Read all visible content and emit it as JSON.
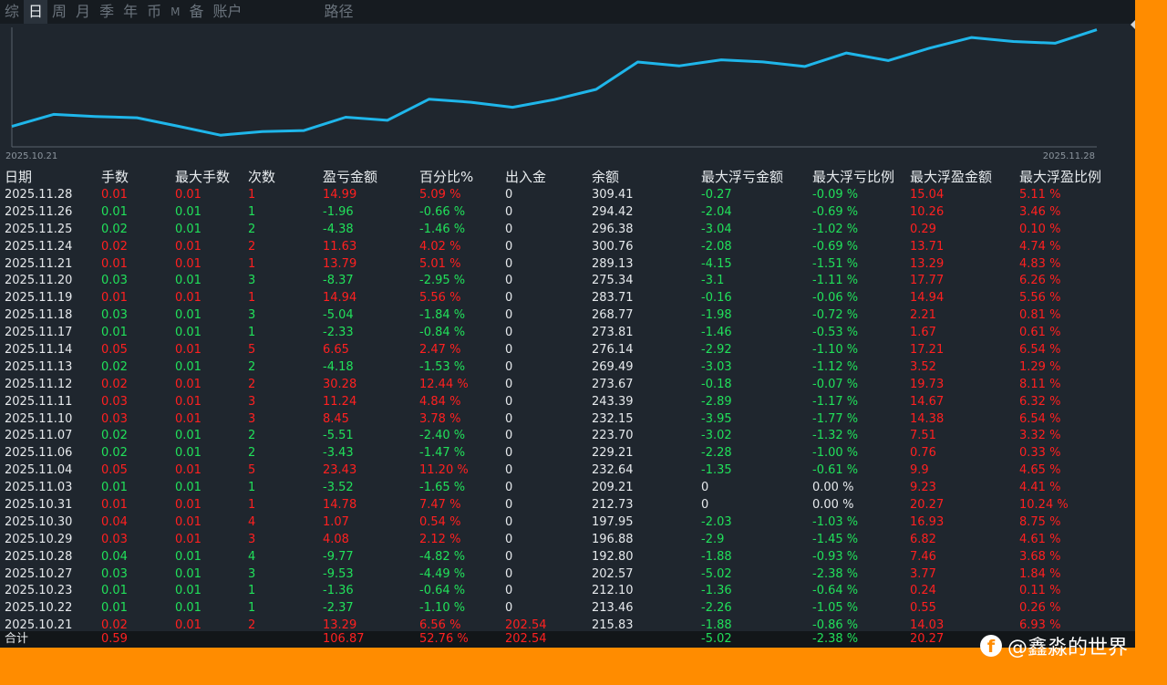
{
  "tabs": [
    "综",
    "日",
    "周",
    "月",
    "季",
    "年",
    "币",
    "M",
    "备",
    "账户",
    "路径"
  ],
  "active_tab": 1,
  "chart_data": {
    "type": "line",
    "title": "",
    "xlabel": "",
    "ylabel": "",
    "x_start_label": "2025.10.21",
    "x_end_label": "2025.11.28",
    "x": [
      "2025.10.21",
      "2025.10.22",
      "2025.10.23",
      "2025.10.27",
      "2025.10.28",
      "2025.10.29",
      "2025.10.30",
      "2025.10.31",
      "2025.11.03",
      "2025.11.04",
      "2025.11.06",
      "2025.11.07",
      "2025.11.10",
      "2025.11.11",
      "2025.11.12",
      "2025.11.13",
      "2025.11.14",
      "2025.11.17",
      "2025.11.18",
      "2025.11.19",
      "2025.11.20",
      "2025.11.21",
      "2025.11.24",
      "2025.11.25",
      "2025.11.26",
      "2025.11.28"
    ],
    "values": [
      202.54,
      215.83,
      213.46,
      212.1,
      202.57,
      192.8,
      196.88,
      197.95,
      212.73,
      209.21,
      232.64,
      229.21,
      223.7,
      232.15,
      243.39,
      273.67,
      269.49,
      276.14,
      273.81,
      268.77,
      283.71,
      275.34,
      289.13,
      300.76,
      296.38,
      294.42,
      309.41
    ],
    "ylim": [
      190,
      312
    ],
    "grid": false,
    "line_color": "#1fb6ea"
  },
  "table": {
    "headers": [
      "日期",
      "手数",
      "最大手数",
      "次数",
      "盈亏金额",
      "百分比%",
      "出入金",
      "余额",
      "最大浮亏金额",
      "最大浮亏比例",
      "最大浮盈金额",
      "最大浮盈比例"
    ],
    "rows": [
      [
        "2025.11.28",
        "0.01",
        "0.01",
        "1",
        "14.99",
        "5.09 %",
        "0",
        "309.41",
        "-0.27",
        "-0.09 %",
        "15.04",
        "5.11 %"
      ],
      [
        "2025.11.26",
        "0.01",
        "0.01",
        "1",
        "-1.96",
        "-0.66 %",
        "0",
        "294.42",
        "-2.04",
        "-0.69 %",
        "10.26",
        "3.46 %"
      ],
      [
        "2025.11.25",
        "0.02",
        "0.01",
        "2",
        "-4.38",
        "-1.46 %",
        "0",
        "296.38",
        "-3.04",
        "-1.02 %",
        "0.29",
        "0.10 %"
      ],
      [
        "2025.11.24",
        "0.02",
        "0.01",
        "2",
        "11.63",
        "4.02 %",
        "0",
        "300.76",
        "-2.08",
        "-0.69 %",
        "13.71",
        "4.74 %"
      ],
      [
        "2025.11.21",
        "0.01",
        "0.01",
        "1",
        "13.79",
        "5.01 %",
        "0",
        "289.13",
        "-4.15",
        "-1.51 %",
        "13.29",
        "4.83 %"
      ],
      [
        "2025.11.20",
        "0.03",
        "0.01",
        "3",
        "-8.37",
        "-2.95 %",
        "0",
        "275.34",
        "-3.1",
        "-1.11 %",
        "17.77",
        "6.26 %"
      ],
      [
        "2025.11.19",
        "0.01",
        "0.01",
        "1",
        "14.94",
        "5.56 %",
        "0",
        "283.71",
        "-0.16",
        "-0.06 %",
        "14.94",
        "5.56 %"
      ],
      [
        "2025.11.18",
        "0.03",
        "0.01",
        "3",
        "-5.04",
        "-1.84 %",
        "0",
        "268.77",
        "-1.98",
        "-0.72 %",
        "2.21",
        "0.81 %"
      ],
      [
        "2025.11.17",
        "0.01",
        "0.01",
        "1",
        "-2.33",
        "-0.84 %",
        "0",
        "273.81",
        "-1.46",
        "-0.53 %",
        "1.67",
        "0.61 %"
      ],
      [
        "2025.11.14",
        "0.05",
        "0.01",
        "5",
        "6.65",
        "2.47 %",
        "0",
        "276.14",
        "-2.92",
        "-1.10 %",
        "17.21",
        "6.54 %"
      ],
      [
        "2025.11.13",
        "0.02",
        "0.01",
        "2",
        "-4.18",
        "-1.53 %",
        "0",
        "269.49",
        "-3.03",
        "-1.12 %",
        "3.52",
        "1.29 %"
      ],
      [
        "2025.11.12",
        "0.02",
        "0.01",
        "2",
        "30.28",
        "12.44 %",
        "0",
        "273.67",
        "-0.18",
        "-0.07 %",
        "19.73",
        "8.11 %"
      ],
      [
        "2025.11.11",
        "0.03",
        "0.01",
        "3",
        "11.24",
        "4.84 %",
        "0",
        "243.39",
        "-2.89",
        "-1.17 %",
        "14.67",
        "6.32 %"
      ],
      [
        "2025.11.10",
        "0.03",
        "0.01",
        "3",
        "8.45",
        "3.78 %",
        "0",
        "232.15",
        "-3.95",
        "-1.77 %",
        "14.38",
        "6.54 %"
      ],
      [
        "2025.11.07",
        "0.02",
        "0.01",
        "2",
        "-5.51",
        "-2.40 %",
        "0",
        "223.70",
        "-3.02",
        "-1.32 %",
        "7.51",
        "3.32 %"
      ],
      [
        "2025.11.06",
        "0.02",
        "0.01",
        "2",
        "-3.43",
        "-1.47 %",
        "0",
        "229.21",
        "-2.28",
        "-1.00 %",
        "0.76",
        "0.33 %"
      ],
      [
        "2025.11.04",
        "0.05",
        "0.01",
        "5",
        "23.43",
        "11.20 %",
        "0",
        "232.64",
        "-1.35",
        "-0.61 %",
        "9.9",
        "4.65 %"
      ],
      [
        "2025.11.03",
        "0.01",
        "0.01",
        "1",
        "-3.52",
        "-1.65 %",
        "0",
        "209.21",
        "0",
        "0.00 %",
        "9.23",
        "4.41 %"
      ],
      [
        "2025.10.31",
        "0.01",
        "0.01",
        "1",
        "14.78",
        "7.47 %",
        "0",
        "212.73",
        "0",
        "0.00 %",
        "20.27",
        "10.24 %"
      ],
      [
        "2025.10.30",
        "0.04",
        "0.01",
        "4",
        "1.07",
        "0.54 %",
        "0",
        "197.95",
        "-2.03",
        "-1.03 %",
        "16.93",
        "8.75 %"
      ],
      [
        "2025.10.29",
        "0.03",
        "0.01",
        "3",
        "4.08",
        "2.12 %",
        "0",
        "196.88",
        "-2.9",
        "-1.45 %",
        "6.82",
        "4.61 %"
      ],
      [
        "2025.10.28",
        "0.04",
        "0.01",
        "4",
        "-9.77",
        "-4.82 %",
        "0",
        "192.80",
        "-1.88",
        "-0.93 %",
        "7.46",
        "3.68 %"
      ],
      [
        "2025.10.27",
        "0.03",
        "0.01",
        "3",
        "-9.53",
        "-4.49 %",
        "0",
        "202.57",
        "-5.02",
        "-2.38 %",
        "3.77",
        "1.84 %"
      ],
      [
        "2025.10.23",
        "0.01",
        "0.01",
        "1",
        "-1.36",
        "-0.64 %",
        "0",
        "212.10",
        "-1.36",
        "-0.64 %",
        "0.24",
        "0.11 %"
      ],
      [
        "2025.10.22",
        "0.01",
        "0.01",
        "1",
        "-2.37",
        "-1.10 %",
        "0",
        "213.46",
        "-2.26",
        "-1.05 %",
        "0.55",
        "0.26 %"
      ],
      [
        "2025.10.21",
        "0.02",
        "0.01",
        "2",
        "13.29",
        "6.56 %",
        "202.54",
        "215.83",
        "-1.88",
        "-0.86 %",
        "14.03",
        "6.93 %"
      ]
    ],
    "total": {
      "label": "合计",
      "lots": "0.59",
      "pnl": "106.87",
      "pct": "52.76 %",
      "deposit": "202.54",
      "max_float_loss": "-5.02",
      "max_float_loss_pct": "-2.38 %",
      "max_float_profit": "20.27"
    }
  },
  "watermark": {
    "icon_text": "f",
    "text": "@鑫淼的世界"
  },
  "colors": {
    "profit": "#ff2020",
    "loss": "#21e05a",
    "neutral": "#e6e9ec",
    "background": "#1f262e",
    "frame": "#ff8c00"
  }
}
